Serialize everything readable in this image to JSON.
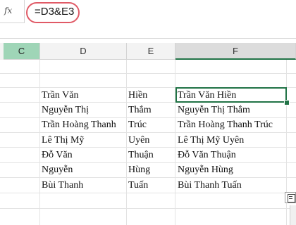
{
  "formula_bar": {
    "fx_label": "fx",
    "formula": "=D3&E3"
  },
  "columns": [
    {
      "id": "C",
      "label": "C"
    },
    {
      "id": "D",
      "label": "D"
    },
    {
      "id": "E",
      "label": "E"
    },
    {
      "id": "F",
      "label": "F"
    }
  ],
  "rows": [
    {
      "d": "Trần Văn",
      "e": "Hiền",
      "f": "Trần Văn Hiền"
    },
    {
      "d": "Nguyễn Thị",
      "e": "Thắm",
      "f": "Nguyễn Thị Thắm"
    },
    {
      "d": "Trần Hoàng Thanh",
      "e": "Trúc",
      "f": "Trần Hoàng Thanh Trúc"
    },
    {
      "d": "Lê Thị Mỹ",
      "e": "Uyên",
      "f": "Lê Thị Mỹ Uyên"
    },
    {
      "d": "Đỗ Văn",
      "e": "Thuận",
      "f": "Đỗ Văn Thuận"
    },
    {
      "d": "Nguyễn",
      "e": "Hùng",
      "f": "Nguyễn Hùng"
    },
    {
      "d": "Bùi Thanh",
      "e": "Tuấn",
      "f": "Bùi Thanh Tuấn"
    }
  ],
  "colors": {
    "accent": "#217346",
    "highlight_ring": "#e05a66",
    "selected_column_header": "#9fd5b7"
  }
}
